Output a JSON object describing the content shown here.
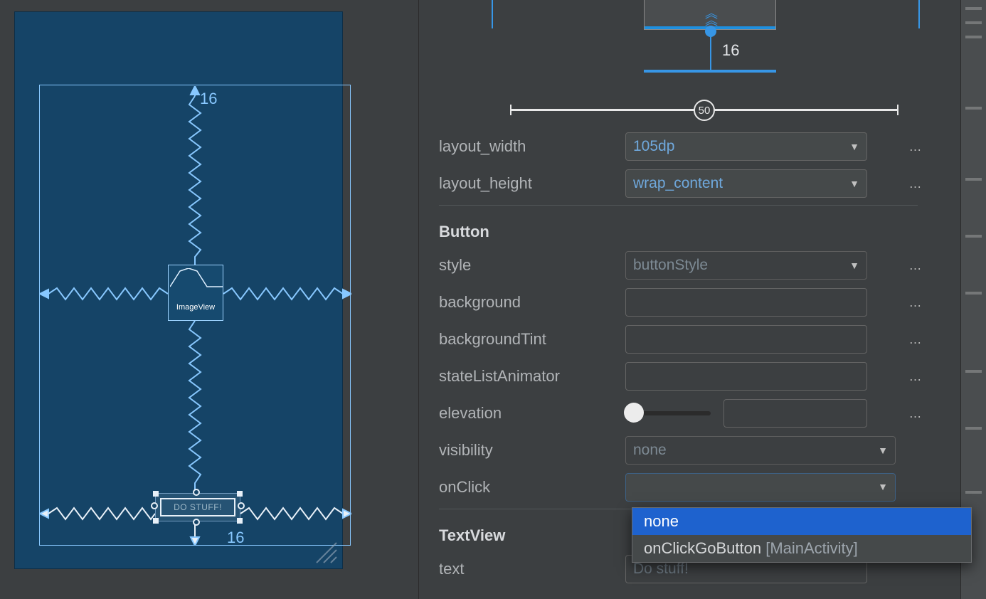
{
  "design": {
    "margin_top": "16",
    "margin_bottom": "16",
    "image_view_label": "ImageView",
    "button_text": "DO STUFF!"
  },
  "constraint_widget": {
    "bias_value": "50",
    "bottom_margin": "16"
  },
  "props": {
    "layout_width": {
      "label": "layout_width",
      "value": "105dp"
    },
    "layout_height": {
      "label": "layout_height",
      "value": "wrap_content"
    },
    "button_section": "Button",
    "style": {
      "label": "style",
      "value": "buttonStyle"
    },
    "background": {
      "label": "background"
    },
    "backgroundTint": {
      "label": "backgroundTint"
    },
    "stateListAnimator": {
      "label": "stateListAnimator"
    },
    "elevation": {
      "label": "elevation"
    },
    "visibility": {
      "label": "visibility",
      "value": "none"
    },
    "onClick": {
      "label": "onClick",
      "value": ""
    },
    "textview_section": "TextView",
    "text": {
      "label": "text",
      "value": "Do stuff!"
    }
  },
  "dropdown": {
    "options": [
      {
        "label": "none",
        "context": ""
      },
      {
        "label": "onClickGoButton ",
        "context": "[MainActivity]"
      }
    ]
  },
  "more_glyph": "…"
}
